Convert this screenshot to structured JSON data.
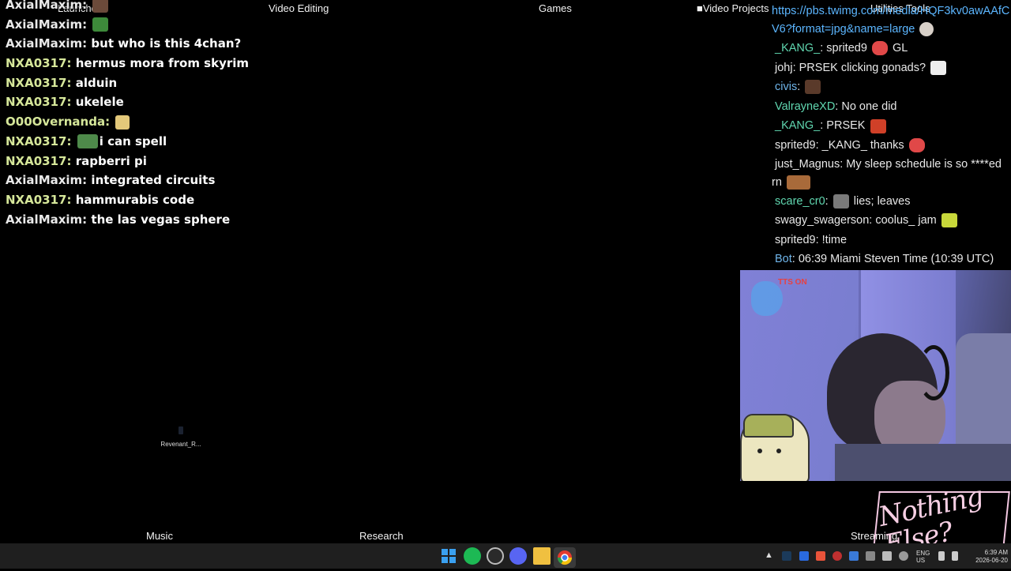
{
  "desktop": {
    "fence_labels": {
      "launcher": "Launche",
      "video_editing": "Video Editing",
      "games": "Games",
      "video_projects": "Video Projects",
      "utilities": "Utilities Tools",
      "music": "Music",
      "research": "Research",
      "streaming": "Streaming"
    },
    "desktop_icon_label": "Revenant_R..."
  },
  "left_chat": [
    {
      "user": "AxialMaxim:",
      "message": ""
    },
    {
      "user": "AxialMaxim:",
      "message": ""
    },
    {
      "user": "AxialMaxim:",
      "message": "but who is this 4chan?"
    },
    {
      "user": "NXA0317:",
      "message": "hermus mora from skyrim"
    },
    {
      "user": "NXA0317:",
      "message": "alduin"
    },
    {
      "user": "NXA0317:",
      "message": "ukelele"
    },
    {
      "user": "O00Overnanda:",
      "message": ""
    },
    {
      "user": "NXA0317:",
      "message": "i can spell"
    },
    {
      "user": "NXA0317:",
      "message": "rapberri pi"
    },
    {
      "user": "AxialMaxim:",
      "message": "integrated circuits"
    },
    {
      "user": "NXA0317:",
      "message": "hammurabis code"
    },
    {
      "user": "AxialMaxim:",
      "message": "the las vegas sphere"
    }
  ],
  "right_chat": {
    "link": "https://pbs.twimg.com/media/HQF3kv0awAAfCV6?format=jpg&name=large",
    "lines": [
      {
        "user": "_KANG_",
        "message": "sprited9",
        "suffix": "GL"
      },
      {
        "user": "johj",
        "message": "PRSEK clicking gonads?"
      },
      {
        "user": "civis",
        "message": ""
      },
      {
        "user": "ValrayneXD",
        "message": "No one did"
      },
      {
        "user": "_KANG_",
        "message": "PRSEK"
      },
      {
        "user": "sprited9",
        "message": "_KANG_ thanks"
      },
      {
        "user": "just_Magnus",
        "message": "My sleep schedule is so ****ed rn"
      },
      {
        "user": "scare_cr0",
        "message": "lies; leaves"
      },
      {
        "user": "swagy_swagerson",
        "message": "coolus_ jam"
      },
      {
        "user": "sprited9",
        "message": "!time"
      },
      {
        "user": "Bot",
        "message": "06:39 Miami Steven Time (10:39 UTC)"
      }
    ]
  },
  "webcam": {
    "overlay_text": "TTS ON"
  },
  "logo": {
    "text": "Nothing Else?"
  },
  "taskbar": {
    "clock_time": "6:39 AM",
    "clock_date": "2026-06-20",
    "lang_top": "ENG",
    "lang_bottom": "US"
  },
  "colors": {
    "left_user_default": "#e9e9e9",
    "left_user_nxa": "#d6e79a",
    "right_link": "#5cb6ff",
    "right_teal": "#60d7b0",
    "right_blue": "#6fb5ea"
  }
}
